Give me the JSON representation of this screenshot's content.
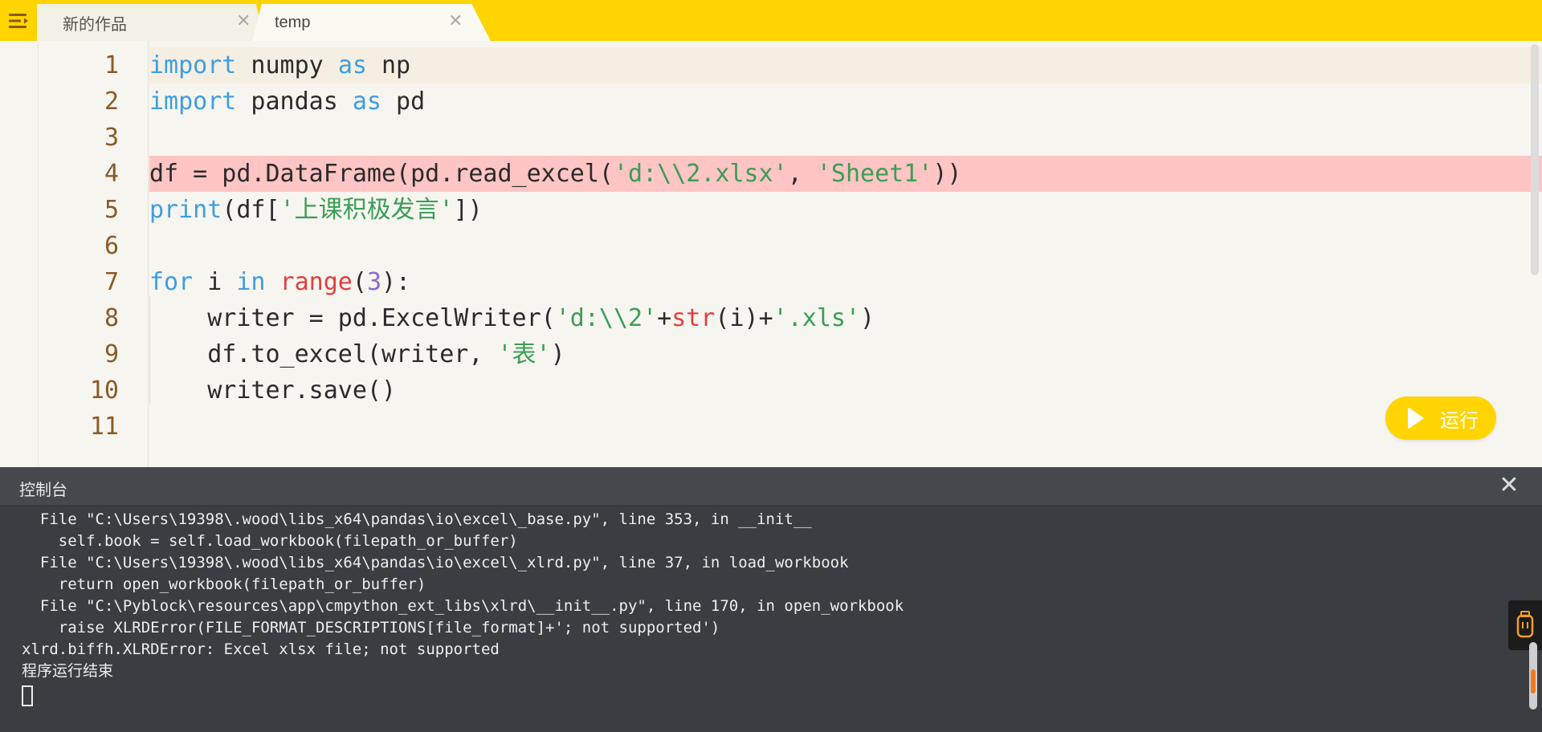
{
  "tabs": [
    {
      "label": "新的作品",
      "active": false
    },
    {
      "label": "temp",
      "active": true
    }
  ],
  "tab_close_glyph": "✕",
  "editor": {
    "line_numbers": [
      "1",
      "2",
      "3",
      "4",
      "5",
      "6",
      "7",
      "8",
      "9",
      "10",
      "11"
    ],
    "lines": [
      {
        "tokens": [
          {
            "t": "import",
            "c": "kw"
          },
          {
            "t": " numpy ",
            "c": ""
          },
          {
            "t": "as",
            "c": "kw"
          },
          {
            "t": " np",
            "c": ""
          }
        ],
        "state": "active"
      },
      {
        "tokens": [
          {
            "t": "import",
            "c": "kw"
          },
          {
            "t": " pandas ",
            "c": ""
          },
          {
            "t": "as",
            "c": "kw"
          },
          {
            "t": " pd",
            "c": ""
          }
        ],
        "state": ""
      },
      {
        "tokens": [],
        "state": ""
      },
      {
        "tokens": [
          {
            "t": "df = pd.DataFrame(pd.read_excel(",
            "c": ""
          },
          {
            "t": "'d:\\\\2.xlsx'",
            "c": "st"
          },
          {
            "t": ", ",
            "c": ""
          },
          {
            "t": "'Sheet1'",
            "c": "st"
          },
          {
            "t": "))",
            "c": ""
          }
        ],
        "state": "error"
      },
      {
        "tokens": [
          {
            "t": "print",
            "c": "kw"
          },
          {
            "t": "(df[",
            "c": ""
          },
          {
            "t": "'上课积极发言'",
            "c": "st"
          },
          {
            "t": "])",
            "c": ""
          }
        ],
        "state": ""
      },
      {
        "tokens": [],
        "state": ""
      },
      {
        "tokens": [
          {
            "t": "for",
            "c": "kw"
          },
          {
            "t": " i ",
            "c": ""
          },
          {
            "t": "in",
            "c": "kw"
          },
          {
            "t": " ",
            "c": ""
          },
          {
            "t": "range",
            "c": "bi"
          },
          {
            "t": "(",
            "c": ""
          },
          {
            "t": "3",
            "c": "nm"
          },
          {
            "t": "):",
            "c": ""
          }
        ],
        "state": ""
      },
      {
        "tokens": [
          {
            "t": "    writer = pd.ExcelWriter(",
            "c": ""
          },
          {
            "t": "'d:\\\\2'",
            "c": "st"
          },
          {
            "t": "+",
            "c": ""
          },
          {
            "t": "str",
            "c": "bi"
          },
          {
            "t": "(i)+",
            "c": ""
          },
          {
            "t": "'.xls'",
            "c": "st"
          },
          {
            "t": ")",
            "c": ""
          }
        ],
        "state": ""
      },
      {
        "tokens": [
          {
            "t": "    df.to_excel(writer, ",
            "c": ""
          },
          {
            "t": "'表'",
            "c": "st"
          },
          {
            "t": ")",
            "c": ""
          }
        ],
        "state": ""
      },
      {
        "tokens": [
          {
            "t": "    writer.save()",
            "c": ""
          }
        ],
        "state": ""
      },
      {
        "tokens": [],
        "state": ""
      }
    ]
  },
  "run_button": {
    "label": "运行"
  },
  "console": {
    "title": "控制台",
    "close_glyph": "✕",
    "lines": [
      "  File \"C:\\Users\\19398\\.wood\\libs_x64\\pandas\\io\\excel\\_base.py\", line 353, in __init__",
      "    self.book = self.load_workbook(filepath_or_buffer)",
      "  File \"C:\\Users\\19398\\.wood\\libs_x64\\pandas\\io\\excel\\_xlrd.py\", line 37, in load_workbook",
      "    return open_workbook(filepath_or_buffer)",
      "  File \"C:\\Pyblock\\resources\\app\\cmpython_ext_libs\\xlrd\\__init__.py\", line 170, in open_workbook",
      "    raise XLRDError(FILE_FORMAT_DESCRIPTIONS[file_format]+'; not supported')",
      "xlrd.biffh.XLRDError: Excel xlsx file; not supported",
      "程序运行结束"
    ]
  },
  "colors": {
    "tabbar": "#ffd400",
    "keyword": "#3d9ee0",
    "builtin": "#e0403c",
    "string": "#3a9e55",
    "number": "#8a6cd1",
    "line_number": "#8b5a24",
    "error_line": "#ffc4c4",
    "console_bg": "#3a3d42"
  },
  "icons": {
    "menu": "menu-icon",
    "play": "play-icon",
    "side_tool": "device-icon"
  }
}
